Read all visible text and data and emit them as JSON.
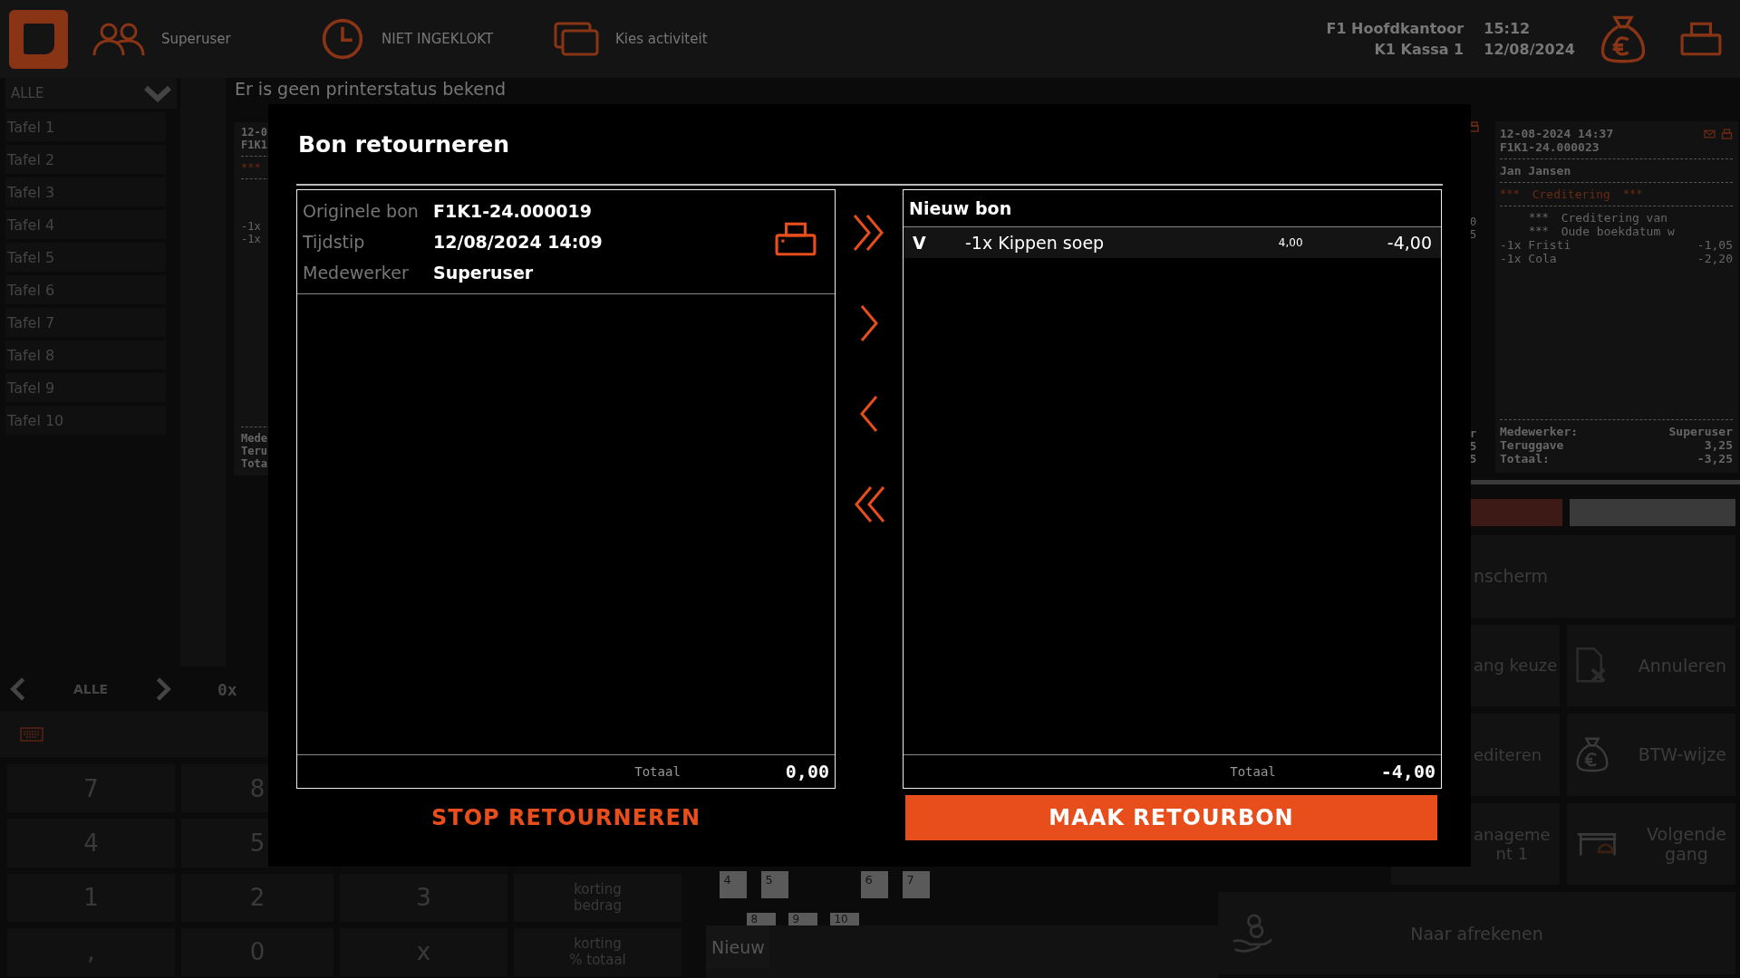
{
  "top_bar": {
    "user": "Superuser",
    "clock_status": "NIET INGEKLOKT",
    "activity": "Kies activiteit",
    "location": "F1 Hoofdkantoor",
    "register": "K1 Kassa 1",
    "time": "15:12",
    "date": "12/08/2024"
  },
  "sidebar": {
    "filter": "ALLE",
    "items": [
      "Tafel 1",
      "Tafel 2",
      "Tafel 3",
      "Tafel 4",
      "Tafel 5",
      "Tafel 6",
      "Tafel 7",
      "Tafel 8",
      "Tafel 9",
      "Tafel 10"
    ]
  },
  "printer_status": "Er is geen printerstatus bekend",
  "left_receipt_fragments": {
    "head": [
      "12-0",
      "F1K1"
    ],
    "stars": "***",
    "lines": [
      "-1x",
      "-1x"
    ],
    "footer": [
      "Mede",
      "Teru",
      "Tota"
    ]
  },
  "middle_receipt_fragments": {
    "lines": [
      "0",
      "5"
    ],
    "footer": [
      "r",
      "5",
      "5"
    ]
  },
  "right_receipt": {
    "datetime": "12-08-2024 14:37",
    "number": "F1K1-24.000023",
    "customer": "Jan Jansen",
    "banner": {
      "stars_left": "***",
      "text": "Creditering",
      "stars_right": "***"
    },
    "notes": [
      {
        "stars": "***",
        "text": "Creditering van"
      },
      {
        "stars": "***",
        "text": "Oude boekdatum w"
      }
    ],
    "lines": [
      {
        "item": "-1x Fristi",
        "amount": "-1,05"
      },
      {
        "item": "-1x Cola",
        "amount": "-2,20"
      }
    ],
    "footer": [
      {
        "label": "Medewerker:",
        "value": "Superuser"
      },
      {
        "label": "Teruggave",
        "value": "3,25"
      },
      {
        "label": "Totaal:",
        "value": "-3,25"
      }
    ]
  },
  "category_nav": {
    "label": "ALLE"
  },
  "order_count": "0x",
  "numpad": [
    [
      "7",
      "8"
    ],
    [
      "4",
      "5"
    ],
    [
      "1",
      "2",
      "3",
      "korting\nbedrag"
    ],
    [
      ",",
      "0",
      "x",
      "korting\n% totaal"
    ]
  ],
  "tables": {
    "row_1": [
      "4",
      "5",
      "6",
      "7"
    ],
    "row_2": [
      "8",
      "9",
      "10"
    ]
  },
  "new_button": "Nieuw",
  "action_buttons": [
    {
      "kind": "wide",
      "label": "nscherm"
    },
    {
      "kind": "plain",
      "label": "ang keuze"
    },
    {
      "kind": "document-x",
      "label": "Annuleren"
    },
    {
      "kind": "plain",
      "label": "editeren"
    },
    {
      "kind": "money-bag",
      "label": "BTW-wijze"
    },
    {
      "kind": "plain",
      "label": "anageme\nnt 1"
    },
    {
      "kind": "table-bell",
      "label": "Volgende\ngang"
    },
    {
      "kind": "hand-coin",
      "label": "Naar afrekenen"
    }
  ],
  "modal": {
    "title": "Bon retourneren",
    "original": {
      "fields": [
        {
          "label": "Originele bon",
          "value": "F1K1-24.000019"
        },
        {
          "label": "Tijdstip",
          "value": "12/08/2024 14:09"
        },
        {
          "label": "Medewerker",
          "value": "Superuser"
        }
      ],
      "total_label": "Totaal",
      "total": "0,00"
    },
    "new": {
      "title": "Nieuw bon",
      "lines": [
        {
          "flag": "V",
          "item": "-1x Kippen soep",
          "unit_price": "4,00",
          "amount": "-4,00",
          "selected": true
        }
      ],
      "total_label": "Totaal",
      "total": "-4,00"
    },
    "stop_button": "STOP RETOURNEREN",
    "confirm_button": "MAAK RETOURBON"
  }
}
